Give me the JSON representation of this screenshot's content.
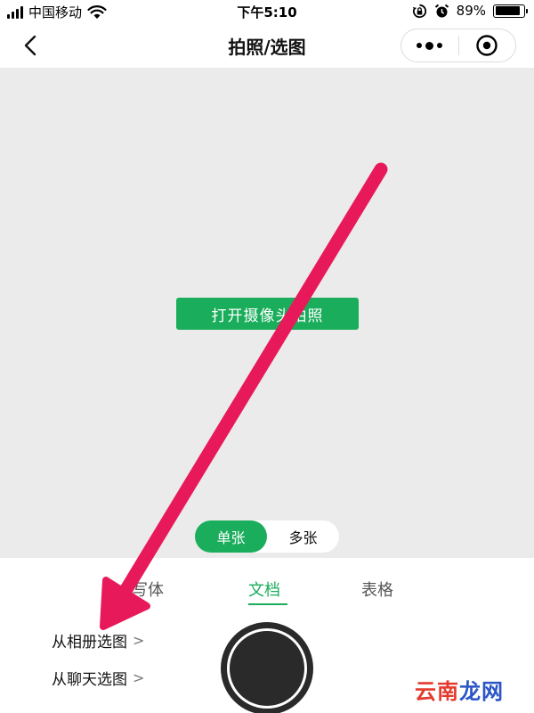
{
  "status_bar": {
    "carrier": "中国移动",
    "time": "下午5:10",
    "battery_pct": "89%",
    "battery_level": 0.89,
    "icons": [
      "signal-icon",
      "wifi-icon",
      "rotation-lock-icon",
      "alarm-icon",
      "battery-icon"
    ]
  },
  "nav": {
    "title": "拍照/选图",
    "back_icon": "chevron-left-icon",
    "more_icon": "more-dots-icon",
    "close_icon": "target-close-icon"
  },
  "preview": {
    "open_camera_label": "打开摄像头拍照",
    "modes": [
      "单张",
      "多张"
    ],
    "active_mode": "单张"
  },
  "tabs": [
    "写体",
    "文档",
    "表格"
  ],
  "active_tab": "文档",
  "pick_options": [
    {
      "label": "从相册选图",
      "chevron": ">"
    },
    {
      "label": "从聊天选图",
      "chevron": ">"
    }
  ],
  "watermark": {
    "part1": "云南",
    "part2": "龙网"
  },
  "colors": {
    "accent": "#1aad5b",
    "preview_bg": "#ebebeb",
    "arrow": "#e8195a"
  }
}
